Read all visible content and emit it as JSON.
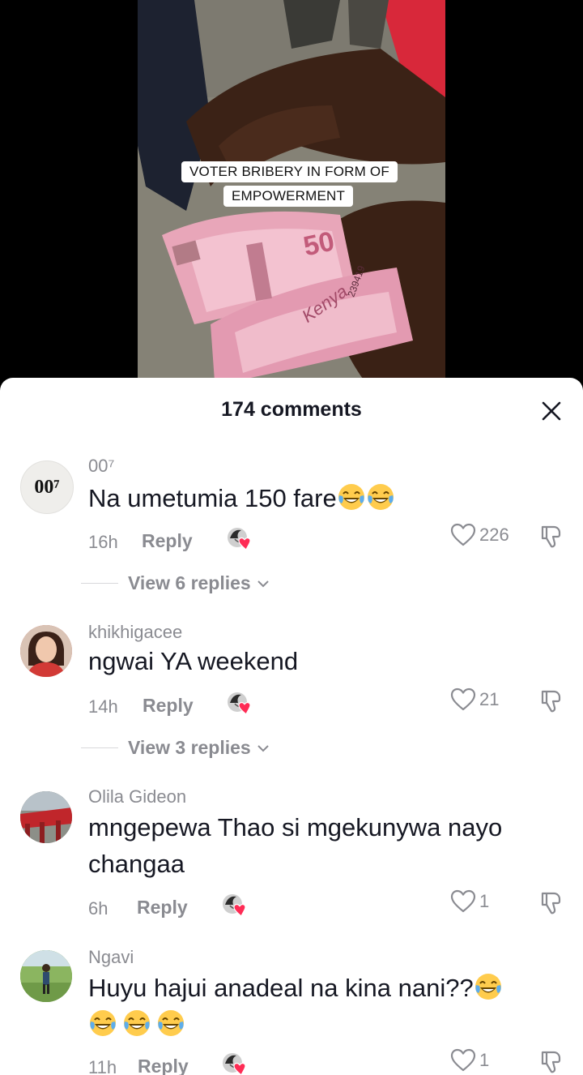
{
  "video": {
    "caption_line1": "VOTER BRIBERY IN FORM OF",
    "caption_line2": "EMPOWERMENT",
    "banknote_value": "50",
    "banknote_word": "Kenya",
    "banknote_serial": "239419"
  },
  "sheet": {
    "title": "174 comments",
    "close_icon": "close-icon"
  },
  "comments": [
    {
      "username": "00⁷",
      "avatar_text": "00⁷",
      "text": "Na umetumia 150 fare",
      "emoji": "joy-emoji",
      "emoji_count": 2,
      "time": "16h",
      "reply_label": "Reply",
      "likes": "226",
      "view_replies": "View 6 replies"
    },
    {
      "username": "khikhigacee",
      "text": "ngwai YA weekend",
      "time": "14h",
      "reply_label": "Reply",
      "likes": "21",
      "view_replies": "View 3 replies"
    },
    {
      "username": "Olila Gideon",
      "text_line1": "mngepewa Thao si mgekunywa nayo",
      "text_line2": "changaa",
      "time": "6h",
      "reply_label": "Reply",
      "likes": "1"
    },
    {
      "username": "Ngavi",
      "text_line1": "Huyu hajui anadeal na kina nani??",
      "emoji": "joy-emoji",
      "emoji_count": 4,
      "time": "11h",
      "reply_label": "Reply",
      "likes": "1"
    }
  ],
  "colors": {
    "accent_heart": "#fe2c55",
    "secondary_text": "#8a8b91",
    "primary_text": "#161823"
  }
}
